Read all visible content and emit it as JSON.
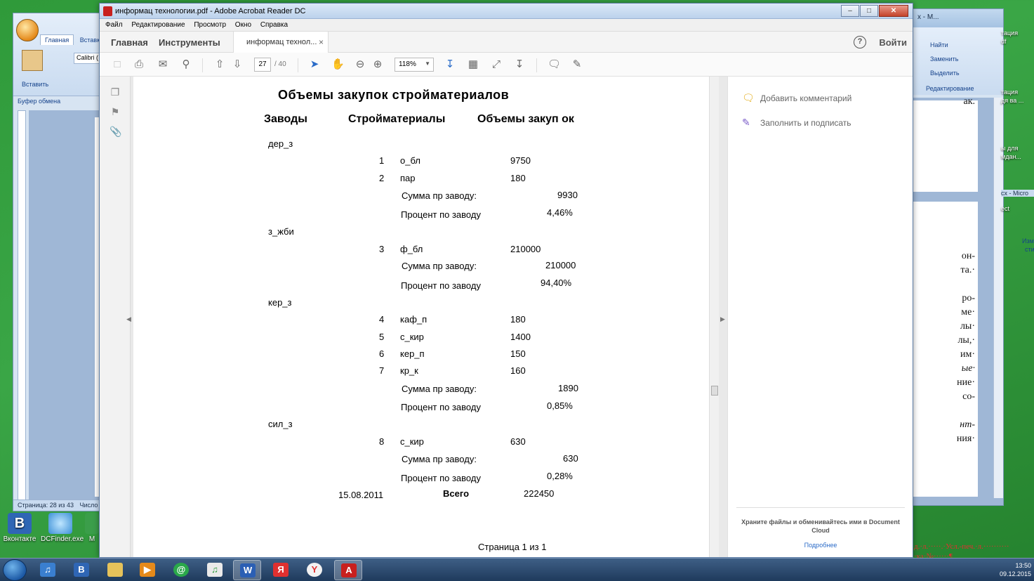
{
  "desktop": {
    "icons": [
      {
        "label": "Вконтакте"
      },
      {
        "label": "DCFinder.exe"
      },
      {
        "label": "М"
      }
    ]
  },
  "word_left": {
    "tabs": [
      "Главная",
      "Вставка"
    ],
    "paste_label": "Вставить",
    "font_name": "Calibri (",
    "clipboard_label": "Буфер обмена",
    "status": "Страница: 28 из 43",
    "status2": "Число"
  },
  "word_right": {
    "title": "x - М...",
    "find": "Найти",
    "replace": "Заменить",
    "select": "Выделить",
    "editing": "Редактирование",
    "doc_lines": [
      "ак.",
      "он-",
      "та.·",
      "ро-",
      "ме·",
      "лы·",
      "лы,·",
      "им·",
      "ые·",
      "ние·",
      "со-",
      "нт-",
      "ния·"
    ]
  },
  "far_right": {
    "labels": [
      "тация",
      "df",
      "тация",
      "дя ва ...",
      "ы для",
      "мдан...",
      "cx - Micro",
      "ect",
      "Изм",
      "сти"
    ]
  },
  "acrobat": {
    "window_title": "информац технологии.pdf - Adobe Acrobat Reader DC",
    "menu": [
      "Файл",
      "Редактирование",
      "Просмотр",
      "Окно",
      "Справка"
    ],
    "nav_home": "Главная",
    "nav_tools": "Инструменты",
    "doc_tab": "информац технол...",
    "login": "Войти",
    "page_current": "27",
    "page_total": "/ 40",
    "zoom": "118%",
    "right_pane": {
      "add_comment": "Добавить комментарий",
      "fill_sign": "Заполнить и подписать",
      "footer_text": "Храните файлы и обменивайтесь ими в Document Cloud",
      "footer_link": "Подробнее"
    }
  },
  "pdf": {
    "title": "Объемы закупок стройматериалов",
    "headers": {
      "plants": "Заводы",
      "materials": "Стройматериалы",
      "volumes": "Объемы закуп ок"
    },
    "groups": [
      {
        "plant": "дер_з",
        "rows": [
          {
            "n": "1",
            "mat": "о_бл",
            "vol": "9750"
          },
          {
            "n": "2",
            "mat": "пар",
            "vol": "180"
          }
        ],
        "sum_label": "Сумма пр заводу:",
        "sum": "9930",
        "pct_label": "Процент по заводу",
        "pct": "4,46%"
      },
      {
        "plant": "з_жби",
        "rows": [
          {
            "n": "3",
            "mat": "ф_бл",
            "vol": "210000"
          }
        ],
        "sum_label": "Сумма пр заводу:",
        "sum": "210000",
        "pct_label": "Процент по заводу",
        "pct": "94,40%"
      },
      {
        "plant": "кер_з",
        "rows": [
          {
            "n": "4",
            "mat": "каф_п",
            "vol": "180"
          },
          {
            "n": "5",
            "mat": "с_кир",
            "vol": "1400"
          },
          {
            "n": "6",
            "mat": "кер_п",
            "vol": "150"
          },
          {
            "n": "7",
            "mat": "кр_к",
            "vol": "160"
          }
        ],
        "sum_label": "Сумма пр заводу:",
        "sum": "1890",
        "pct_label": "Процент по заводу",
        "pct": "0,85%"
      },
      {
        "plant": "сил_з",
        "rows": [
          {
            "n": "8",
            "mat": "с_кир",
            "vol": "630"
          }
        ],
        "sum_label": "Сумма пр заводу:",
        "sum": "630",
        "pct_label": "Процент по заводу",
        "pct": "0,28%"
      }
    ],
    "date": "15.08.2011",
    "total_label": "Всего",
    "total": "222450",
    "page_footer": "Страница 1 из  1"
  },
  "taskbar": {
    "time": "13:50",
    "date": "09.12.2015"
  },
  "bg_text": {
    "line1": "д.·л.·····.·Усл.-печ.·л.··········",
    "line2": "·ка·№······¶"
  }
}
